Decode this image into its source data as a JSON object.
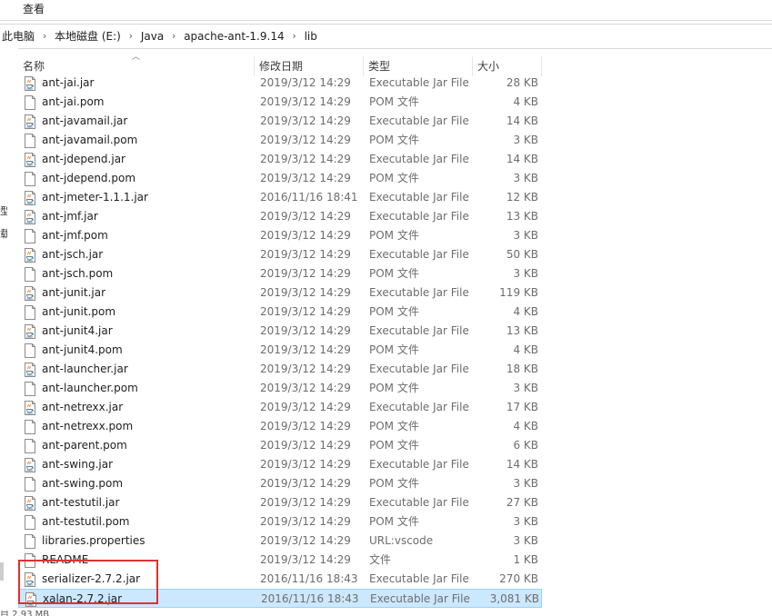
{
  "ribbon": {
    "view_tab": "查看"
  },
  "breadcrumb": [
    "此电脑",
    "本地磁盘 (E:)",
    "Java",
    "apache-ant-1.9.14",
    "lib"
  ],
  "nav_fragments": [
    "型",
    "载"
  ],
  "columns": {
    "name": "名称",
    "date": "修改日期",
    "type": "类型",
    "size": "大小"
  },
  "files": [
    {
      "name": "ant-jai.jar",
      "date": "2019/3/12 14:29",
      "type": "Executable Jar File",
      "size": "28 KB",
      "icon": "jar-file-icon"
    },
    {
      "name": "ant-jai.pom",
      "date": "2019/3/12 14:29",
      "type": "POM 文件",
      "size": "4 KB",
      "icon": "blank-file-icon"
    },
    {
      "name": "ant-javamail.jar",
      "date": "2019/3/12 14:29",
      "type": "Executable Jar File",
      "size": "14 KB",
      "icon": "jar-file-icon"
    },
    {
      "name": "ant-javamail.pom",
      "date": "2019/3/12 14:29",
      "type": "POM 文件",
      "size": "3 KB",
      "icon": "blank-file-icon"
    },
    {
      "name": "ant-jdepend.jar",
      "date": "2019/3/12 14:29",
      "type": "Executable Jar File",
      "size": "14 KB",
      "icon": "jar-file-icon"
    },
    {
      "name": "ant-jdepend.pom",
      "date": "2019/3/12 14:29",
      "type": "POM 文件",
      "size": "3 KB",
      "icon": "blank-file-icon"
    },
    {
      "name": "ant-jmeter-1.1.1.jar",
      "date": "2016/11/16 18:41",
      "type": "Executable Jar File",
      "size": "12 KB",
      "icon": "jar-file-icon"
    },
    {
      "name": "ant-jmf.jar",
      "date": "2019/3/12 14:29",
      "type": "Executable Jar File",
      "size": "13 KB",
      "icon": "jar-file-icon"
    },
    {
      "name": "ant-jmf.pom",
      "date": "2019/3/12 14:29",
      "type": "POM 文件",
      "size": "3 KB",
      "icon": "blank-file-icon"
    },
    {
      "name": "ant-jsch.jar",
      "date": "2019/3/12 14:29",
      "type": "Executable Jar File",
      "size": "50 KB",
      "icon": "jar-file-icon"
    },
    {
      "name": "ant-jsch.pom",
      "date": "2019/3/12 14:29",
      "type": "POM 文件",
      "size": "3 KB",
      "icon": "blank-file-icon"
    },
    {
      "name": "ant-junit.jar",
      "date": "2019/3/12 14:29",
      "type": "Executable Jar File",
      "size": "119 KB",
      "icon": "jar-file-icon"
    },
    {
      "name": "ant-junit.pom",
      "date": "2019/3/12 14:29",
      "type": "POM 文件",
      "size": "4 KB",
      "icon": "blank-file-icon"
    },
    {
      "name": "ant-junit4.jar",
      "date": "2019/3/12 14:29",
      "type": "Executable Jar File",
      "size": "13 KB",
      "icon": "jar-file-icon"
    },
    {
      "name": "ant-junit4.pom",
      "date": "2019/3/12 14:29",
      "type": "POM 文件",
      "size": "4 KB",
      "icon": "blank-file-icon"
    },
    {
      "name": "ant-launcher.jar",
      "date": "2019/3/12 14:29",
      "type": "Executable Jar File",
      "size": "18 KB",
      "icon": "jar-file-icon"
    },
    {
      "name": "ant-launcher.pom",
      "date": "2019/3/12 14:29",
      "type": "POM 文件",
      "size": "3 KB",
      "icon": "blank-file-icon"
    },
    {
      "name": "ant-netrexx.jar",
      "date": "2019/3/12 14:29",
      "type": "Executable Jar File",
      "size": "17 KB",
      "icon": "jar-file-icon"
    },
    {
      "name": "ant-netrexx.pom",
      "date": "2019/3/12 14:29",
      "type": "POM 文件",
      "size": "4 KB",
      "icon": "blank-file-icon"
    },
    {
      "name": "ant-parent.pom",
      "date": "2019/3/12 14:29",
      "type": "POM 文件",
      "size": "6 KB",
      "icon": "blank-file-icon"
    },
    {
      "name": "ant-swing.jar",
      "date": "2019/3/12 14:29",
      "type": "Executable Jar File",
      "size": "14 KB",
      "icon": "jar-file-icon"
    },
    {
      "name": "ant-swing.pom",
      "date": "2019/3/12 14:29",
      "type": "POM 文件",
      "size": "3 KB",
      "icon": "blank-file-icon"
    },
    {
      "name": "ant-testutil.jar",
      "date": "2019/3/12 14:29",
      "type": "Executable Jar File",
      "size": "27 KB",
      "icon": "jar-file-icon"
    },
    {
      "name": "ant-testutil.pom",
      "date": "2019/3/12 14:29",
      "type": "POM 文件",
      "size": "3 KB",
      "icon": "blank-file-icon"
    },
    {
      "name": "libraries.properties",
      "date": "2019/3/12 14:29",
      "type": "URL:vscode",
      "size": "3 KB",
      "icon": "blank-file-icon"
    },
    {
      "name": "README",
      "date": "2019/3/12 14:29",
      "type": "文件",
      "size": "1 KB",
      "icon": "blank-file-icon"
    },
    {
      "name": "serializer-2.7.2.jar",
      "date": "2016/11/16 18:43",
      "type": "Executable Jar File",
      "size": "270 KB",
      "icon": "jar-file-icon"
    },
    {
      "name": "xalan-2.7.2.jar",
      "date": "2016/11/16 18:43",
      "type": "Executable Jar File",
      "size": "3,081 KB",
      "icon": "jar-file-icon",
      "selected": true
    }
  ],
  "status": {
    "text": "目 2.93 MB"
  },
  "colors": {
    "selection_bg": "#cce8ff",
    "selection_border": "#99d1ff",
    "annotation_box": "#e0312f"
  }
}
